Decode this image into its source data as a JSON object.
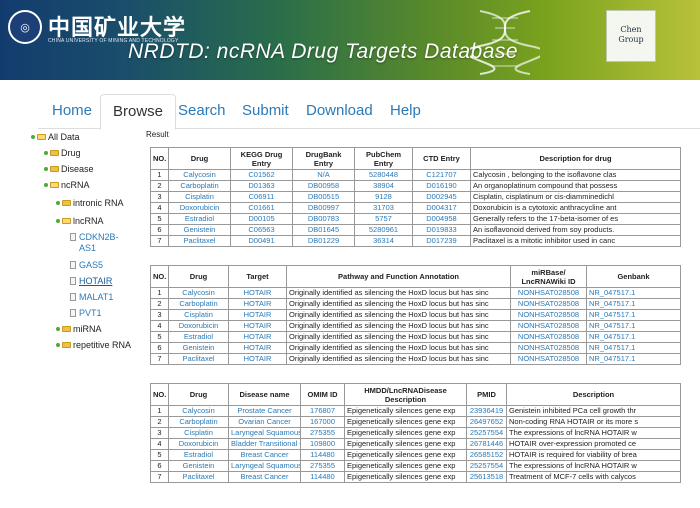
{
  "banner": {
    "university_cn": "中国矿业大学",
    "university_en": "CHINA UNIVERSITY OF MINING AND TECHNOLOGY",
    "title": "NRDTD: ncRNA Drug Targets Database",
    "group_logo_line1": "Chen",
    "group_logo_line2": "Group"
  },
  "nav": {
    "tabs": [
      {
        "label": "Home",
        "active": false
      },
      {
        "label": "Browse",
        "active": true
      },
      {
        "label": "Search",
        "active": false
      },
      {
        "label": "Submit",
        "active": false
      },
      {
        "label": "Download",
        "active": false
      },
      {
        "label": "Help",
        "active": false
      }
    ]
  },
  "tree": {
    "all_data": "All Data",
    "drug": "Drug",
    "disease": "Disease",
    "ncrna": "ncRNA",
    "intronic": "intronic RNA",
    "lncrna": "lncRNA",
    "leaves": [
      "CDKN2B-",
      "AS1",
      "GAS5",
      "HOTAIR",
      "MALAT1",
      "PVT1"
    ],
    "mirna": "miRNA",
    "repetitive": "repetitive RNA"
  },
  "result_label": "Result",
  "table1": {
    "headers": [
      "NO.",
      "Drug",
      "KEGG Drug Entry",
      "DrugBank Entry",
      "PubChem Entry",
      "CTD Entry",
      "Description for drug"
    ],
    "rows": [
      [
        "1",
        "Calycosin",
        "C01562",
        "N/A",
        "5280448",
        "C121707",
        "Calycosin , belonging to the isoflavone clas"
      ],
      [
        "2",
        "Carboplatin",
        "D01363",
        "DB00958",
        "38904",
        "D016190",
        "An organoplatinum compound that possess"
      ],
      [
        "3",
        "Cisplatin",
        "C06911",
        "DB00515",
        "9128",
        "D002945",
        "Cisplatin, cisplatinum or cis-diamminedichl"
      ],
      [
        "4",
        "Doxorubicin",
        "C01661",
        "DB00997",
        "31703",
        "D004317",
        "Doxorubicin is a cytotoxic anthracycline ant"
      ],
      [
        "5",
        "Estradiol",
        "D00105",
        "DB00783",
        "5757",
        "D004958",
        "Generally refers to the 17-beta-isomer of es"
      ],
      [
        "6",
        "Genistein",
        "C06563",
        "DB01645",
        "5280961",
        "D019833",
        "An isoflavonoid derived from soy products."
      ],
      [
        "7",
        "Paclitaxel",
        "D00491",
        "DB01229",
        "36314",
        "D017239",
        "Paclitaxel is a mitotic inhibitor used in canc"
      ]
    ]
  },
  "table2": {
    "headers": [
      "NO.",
      "Drug",
      "Target",
      "Pathway and Function Annotation",
      "miRBase/ LncRNAWiki ID",
      "Genbank"
    ],
    "rows": [
      [
        "1",
        "Calycosin",
        "HOTAIR",
        "Originally identified as silencing the HoxD locus but has sinc",
        "NONHSAT028508",
        "NR_047517.1"
      ],
      [
        "2",
        "Carboplatin",
        "HOTAIR",
        "Originally identified as silencing the HoxD locus but has sinc",
        "NONHSAT028508",
        "NR_047517.1"
      ],
      [
        "3",
        "Cisplatin",
        "HOTAIR",
        "Originally identified as silencing the HoxD locus but has sinc",
        "NONHSAT028508",
        "NR_047517.1"
      ],
      [
        "4",
        "Doxorubicin",
        "HOTAIR",
        "Originally identified as silencing the HoxD locus but has sinc",
        "NONHSAT028508",
        "NR_047517.1"
      ],
      [
        "5",
        "Estradiol",
        "HOTAIR",
        "Originally identified as silencing the HoxD locus but has sinc",
        "NONHSAT028508",
        "NR_047517.1"
      ],
      [
        "6",
        "Genistein",
        "HOTAIR",
        "Originally identified as silencing the HoxD locus but has sinc",
        "NONHSAT028508",
        "NR_047517.1"
      ],
      [
        "7",
        "Paclitaxel",
        "HOTAIR",
        "Originally identified as silencing the HoxD locus but has sinc",
        "NONHSAT028508",
        "NR_047517.1"
      ]
    ]
  },
  "table3": {
    "headers": [
      "NO.",
      "Drug",
      "Disease name",
      "OMIM ID",
      "HMDD/LncRNADisease Description",
      "PMID",
      "Description"
    ],
    "rows": [
      [
        "1",
        "Calycosin",
        "Prostate Cancer",
        "176807",
        "Epigenetically silences gene exp",
        "23936419",
        "Genistein inhibited PCa cell growth thr"
      ],
      [
        "2",
        "Carboplatin",
        "Ovarian Cancer",
        "167000",
        "Epigenetically silences gene exp",
        "26497652",
        "Non-coding RNA HOTAIR or its more s"
      ],
      [
        "3",
        "Cisplatin",
        "Laryngeal Squamous",
        "275355",
        "Epigenetically silences gene exp",
        "25257554",
        "The expressions of lncRNA HOTAIR w"
      ],
      [
        "4",
        "Doxorubicin",
        "Bladder Transitional C",
        "109800",
        "Epigenetically silences gene exp",
        "26781446",
        "HOTAIR over-expression promoted ce"
      ],
      [
        "5",
        "Estradiol",
        "Breast Cancer",
        "114480",
        "Epigenetically silences gene exp",
        "26585152",
        "HOTAIR is required for viability of brea"
      ],
      [
        "6",
        "Genistein",
        "Laryngeal Squamous",
        "275355",
        "Epigenetically silences gene exp",
        "25257554",
        "The expressions of lncRNA HOTAIR w"
      ],
      [
        "7",
        "Paclitaxel",
        "Breast Cancer",
        "114480",
        "Epigenetically silences gene exp",
        "25613518",
        "Treatment of MCF-7 cells with calycos"
      ]
    ]
  },
  "colors": {
    "link": "#2a7ab8",
    "tree_dot": "#4caa3c",
    "folder": "#f0c040"
  }
}
